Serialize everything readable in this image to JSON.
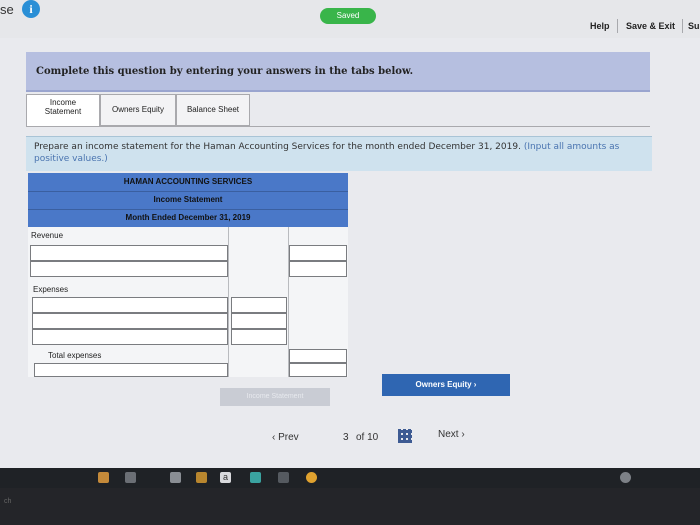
{
  "topbar": {
    "left_fragment": "se",
    "info_glyph": "i",
    "saved": "Saved",
    "help": "Help",
    "save_exit": "Save & Exit",
    "submit_fragment": "Su"
  },
  "banner": "Complete this question by entering your answers in the tabs below.",
  "tabs": [
    {
      "line1": "Income",
      "line2": "Statement",
      "active": true
    },
    {
      "line1": "Owners Equity",
      "line2": "",
      "active": false
    },
    {
      "line1": "Balance Sheet",
      "line2": "",
      "active": false
    }
  ],
  "instructions": {
    "main": "Prepare an income statement for the Haman Accounting Services for the month ended December 31, 2019.",
    "note": "(Input all amounts as positive values.)"
  },
  "statement": {
    "company": "HAMAN ACCOUNTING SERVICES",
    "title": "Income Statement",
    "period": "Month Ended December 31, 2019",
    "rows": {
      "revenue": "Revenue",
      "expenses": "Expenses",
      "total_expenses": "Total expenses"
    }
  },
  "buttons": {
    "next_tab": "Owners Equity  ›",
    "prev_tab": "Income Statement"
  },
  "pager": {
    "prev": "‹  Prev",
    "position": "3",
    "of": "of 10",
    "next": "Next  ›"
  },
  "taskbar": {
    "a_icon": "a"
  },
  "bezel_fragment": "ch",
  "colors": {
    "header_blue": "#4a78c8",
    "banner_lavender": "#b6bfe0",
    "button_blue": "#2f66b2",
    "saved_green": "#39b54a"
  }
}
